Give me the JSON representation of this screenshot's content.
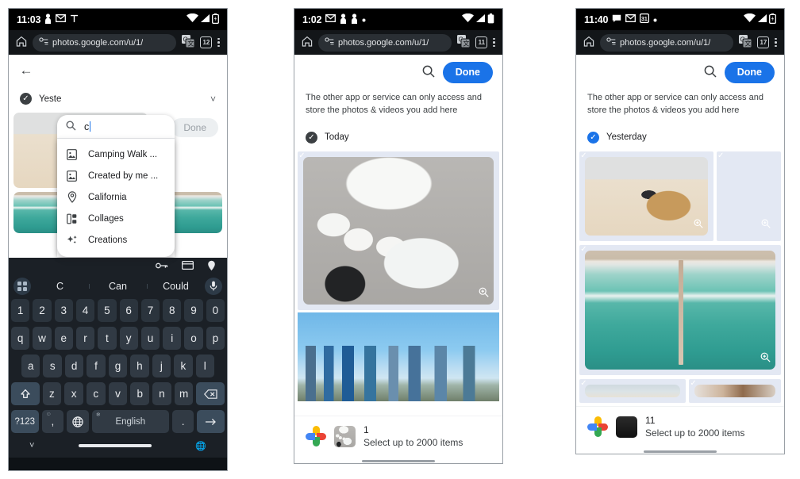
{
  "panels": [
    {
      "id": "panel-1",
      "status": {
        "time": "11:03",
        "left_icons": [
          "person-icon",
          "gmail-icon",
          "signal-t-icon"
        ],
        "right_icons": [
          "wifi-icon",
          "cellular-icon",
          "battery-icon"
        ]
      },
      "browser": {
        "home_icon": "home-icon",
        "site_settings_icon": "page-info-icon",
        "url": "photos.google.com/u/1/",
        "translate_icon": "translate-icon",
        "tab_count": "12",
        "menu_icon": "overflow-menu-icon"
      },
      "picker": {
        "back_icon": "back-arrow-icon",
        "search_icon": "search-icon",
        "typed_query": "c",
        "done_label": "Done",
        "done_enabled": false,
        "suggestions": [
          {
            "icon": "photo-album-icon",
            "label": "Camping Walk ..."
          },
          {
            "icon": "photo-album-icon",
            "label": "Created by me ..."
          },
          {
            "icon": "location-pin-icon",
            "label": "California"
          },
          {
            "icon": "collage-icon",
            "label": "Collages"
          },
          {
            "icon": "sparkle-icon",
            "label": "Creations"
          }
        ],
        "section_label": "Yeste",
        "section_checkbox": "dark-check",
        "chevron_icon": "chevron-down-icon"
      },
      "keyboard": {
        "toolbar_icons": [
          "password-key-icon",
          "payment-card-icon",
          "address-pin-icon"
        ],
        "grid_icon": "app-grid-icon",
        "mic_icon": "microphone-icon",
        "suggestions": [
          "C",
          "Can",
          "Could"
        ],
        "row_numbers": [
          "1",
          "2",
          "3",
          "4",
          "5",
          "6",
          "7",
          "8",
          "9",
          "0"
        ],
        "row_1": [
          "q",
          "w",
          "e",
          "r",
          "t",
          "y",
          "u",
          "i",
          "o",
          "p"
        ],
        "row_2": [
          "a",
          "s",
          "d",
          "f",
          "g",
          "h",
          "j",
          "k",
          "l"
        ],
        "row_3": [
          "z",
          "x",
          "c",
          "v",
          "b",
          "n",
          "m"
        ],
        "shift_icon": "shift-icon",
        "backspace_icon": "backspace-icon",
        "symbols_label": "?123",
        "comma_label": ",",
        "comma_sup": "☺",
        "globe_icon": "language-globe-icon",
        "space_label": "English",
        "space_sup": "paw-icon",
        "period_label": ".",
        "enter_icon": "enter-arrow-icon",
        "nav_down_icon": "collapse-keyboard-icon",
        "nav_globe_icon": "ime-switch-icon"
      }
    },
    {
      "id": "panel-2",
      "status": {
        "time": "1:02",
        "left_icons": [
          "gmail-icon",
          "person-icon",
          "person-icon",
          "dot-icon"
        ],
        "right_icons": [
          "wifi-icon",
          "cellular-icon",
          "battery-icon"
        ]
      },
      "browser": {
        "home_icon": "home-icon",
        "site_settings_icon": "page-info-icon",
        "url": "photos.google.com/u/1/",
        "translate_icon": "translate-icon",
        "tab_count": "11",
        "menu_icon": "overflow-menu-icon"
      },
      "picker": {
        "search_icon": "search-icon",
        "done_label": "Done",
        "done_enabled": true,
        "notice": "The other app or service can only access and store the photos & videos you add here",
        "section_label": "Today",
        "section_checkbox": "dark-check"
      },
      "photos": [
        {
          "name": "korean-bbq-meal",
          "art": "ph-food",
          "selected": true,
          "zoom_icon": "zoom-in-icon"
        },
        {
          "name": "city-skyline-ferris-wheel",
          "art": "ph-city",
          "selected": false,
          "zoom_icon": null
        }
      ],
      "sheet": {
        "logo": "google-photos-logo",
        "thumb": "korean-bbq-thumb",
        "count": "1",
        "subtitle": "Select up to 2000 items"
      }
    },
    {
      "id": "panel-3",
      "status": {
        "time": "11:40",
        "left_icons": [
          "chat-icon",
          "gmail-icon",
          "calendar-31-icon",
          "dot-icon"
        ],
        "right_icons": [
          "wifi-icon",
          "cellular-icon",
          "battery-icon"
        ]
      },
      "browser": {
        "home_icon": "home-icon",
        "site_settings_icon": "page-info-icon",
        "url": "photos.google.com/u/1/",
        "translate_icon": "translate-icon",
        "tab_count": "17",
        "menu_icon": "overflow-menu-icon"
      },
      "picker": {
        "search_icon": "search-icon",
        "done_label": "Done",
        "done_enabled": true,
        "notice": "The other app or service can only access and store the photos & videos you add here",
        "section_label": "Yesterday",
        "section_checkbox": "blue-check"
      },
      "photos": [
        {
          "name": "beach-bag-sandals",
          "art": "ph-beachbag",
          "selected": true,
          "zoom_icon": "zoom-in-icon"
        },
        {
          "name": "rocks-red-jacket",
          "art": "ph-rocks",
          "selected": true,
          "zoom_icon": "zoom-in-icon"
        },
        {
          "name": "aerial-turquoise-pier",
          "art": "ph-aerial",
          "selected": true,
          "zoom_icon": "zoom-in-icon"
        },
        {
          "name": "blurred-beach-row",
          "art": "ph-blurbeach",
          "selected": true,
          "zoom_icon": null
        },
        {
          "name": "blurred-warm-row",
          "art": "ph-blurwarm",
          "selected": true,
          "zoom_icon": null
        }
      ],
      "sheet": {
        "logo": "google-photos-logo",
        "thumb": "black-white-thumb",
        "count": "11",
        "subtitle": "Select up to 2000 items"
      }
    }
  ],
  "colors": {
    "accent_blue": "#1a73e8",
    "status_bar": "#000000",
    "url_bar": "#131619",
    "keyboard_bg": "#1b2026",
    "selected_tile_bg": "#e3e8f3",
    "dark_check": "#3c4043"
  }
}
